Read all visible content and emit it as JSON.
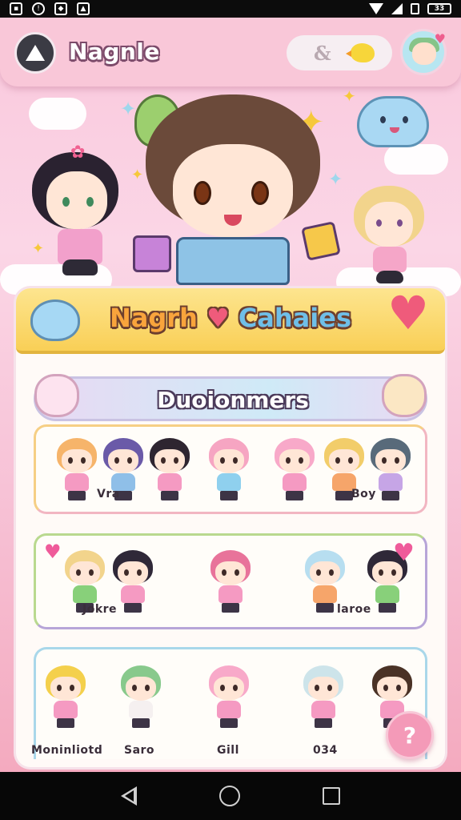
{
  "status_bar": {
    "battery": "33"
  },
  "app_bar": {
    "title": "Nagnle",
    "search_symbol": "&",
    "icons": [
      "menu-avatar-icon",
      "chick-icon",
      "profile-avatar-icon"
    ]
  },
  "card": {
    "title": "Nagrh",
    "title_suffix": "Cahaies",
    "section_title": "Duoionmers"
  },
  "rows": [
    {
      "labels": [
        {
          "text": "Vra"
        },
        {
          "text": "Boy"
        }
      ]
    },
    {
      "labels": [
        {
          "text": "Jokre"
        },
        {
          "text": "laroe"
        }
      ]
    },
    {
      "labels": [
        {
          "text": "Moninliotd"
        },
        {
          "text": "Saro"
        },
        {
          "text": "Gill"
        },
        {
          "text": "034"
        }
      ]
    }
  ],
  "fab": {
    "label": "?"
  },
  "colors": {
    "accent_pink": "#f49ab8",
    "header_yellow": "#f9cf56",
    "title_orange": "#f9a43c"
  }
}
